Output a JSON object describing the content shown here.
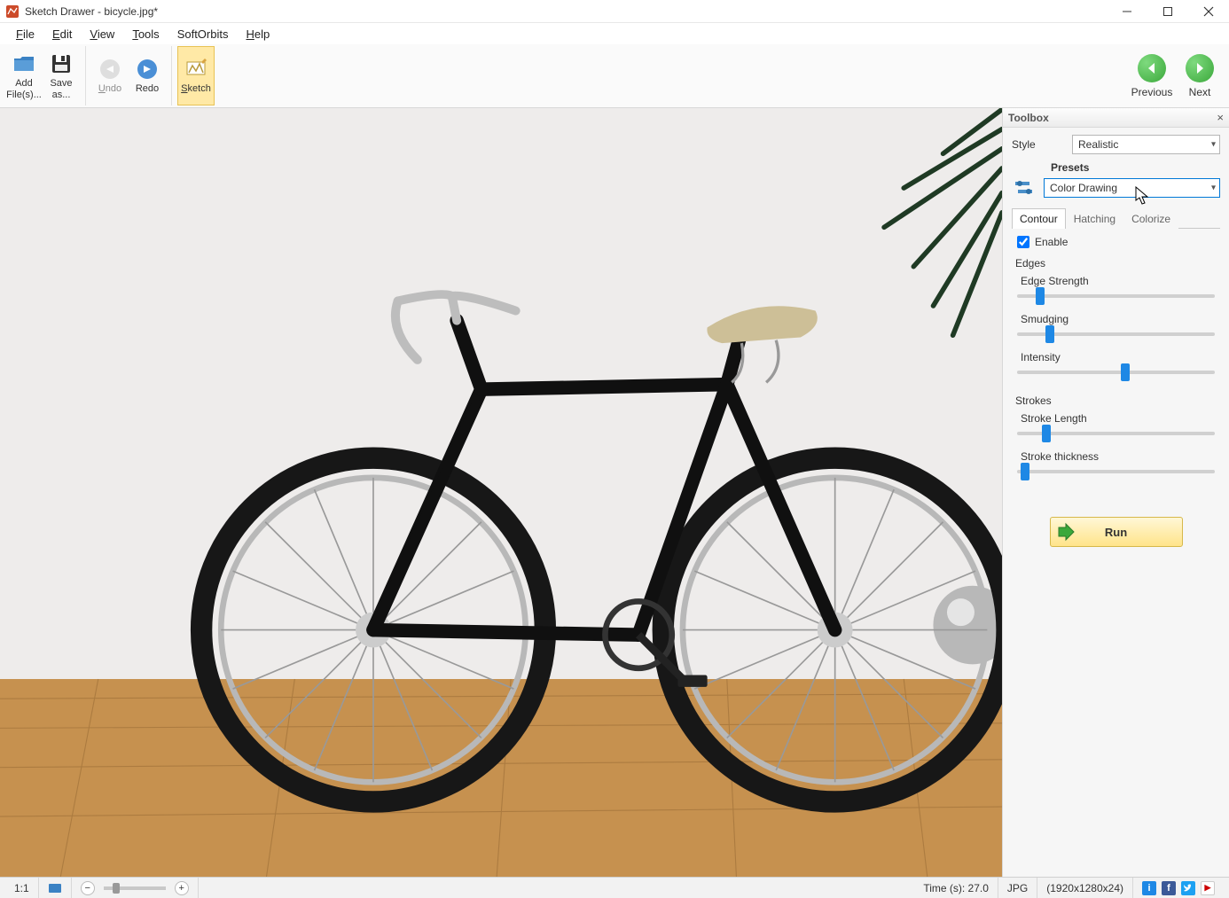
{
  "titlebar": {
    "text": "Sketch Drawer - bicycle.jpg*"
  },
  "menubar": {
    "file": "File",
    "edit": "Edit",
    "view": "View",
    "tools": "Tools",
    "softorbits": "SoftOrbits",
    "help": "Help"
  },
  "toolbar": {
    "add_files": "Add File(s)...",
    "save_as": "Save as...",
    "undo": "Undo",
    "redo": "Redo",
    "sketch": "Sketch",
    "previous": "Previous",
    "next": "Next"
  },
  "toolbox": {
    "title": "Toolbox",
    "style_label": "Style",
    "style_value": "Realistic",
    "presets_label": "Presets",
    "preset_value": "Color Drawing",
    "tabs": {
      "contour": "Contour",
      "hatching": "Hatching",
      "colorize": "Colorize"
    },
    "enable_label": "Enable",
    "enable_checked": true,
    "edges_heading": "Edges",
    "edge_strength_label": "Edge Strength",
    "edge_strength_value": 10,
    "smudging_label": "Smudging",
    "smudging_value": 15,
    "intensity_label": "Intensity",
    "intensity_value": 55,
    "strokes_heading": "Strokes",
    "stroke_length_label": "Stroke Length",
    "stroke_length_value": 13,
    "stroke_thickness_label": "Stroke thickness",
    "stroke_thickness_value": 2,
    "run_label": "Run"
  },
  "statusbar": {
    "ratio": "1:1",
    "time": "Time (s): 27.0",
    "format": "JPG",
    "dimensions": "(1920x1280x24)"
  }
}
